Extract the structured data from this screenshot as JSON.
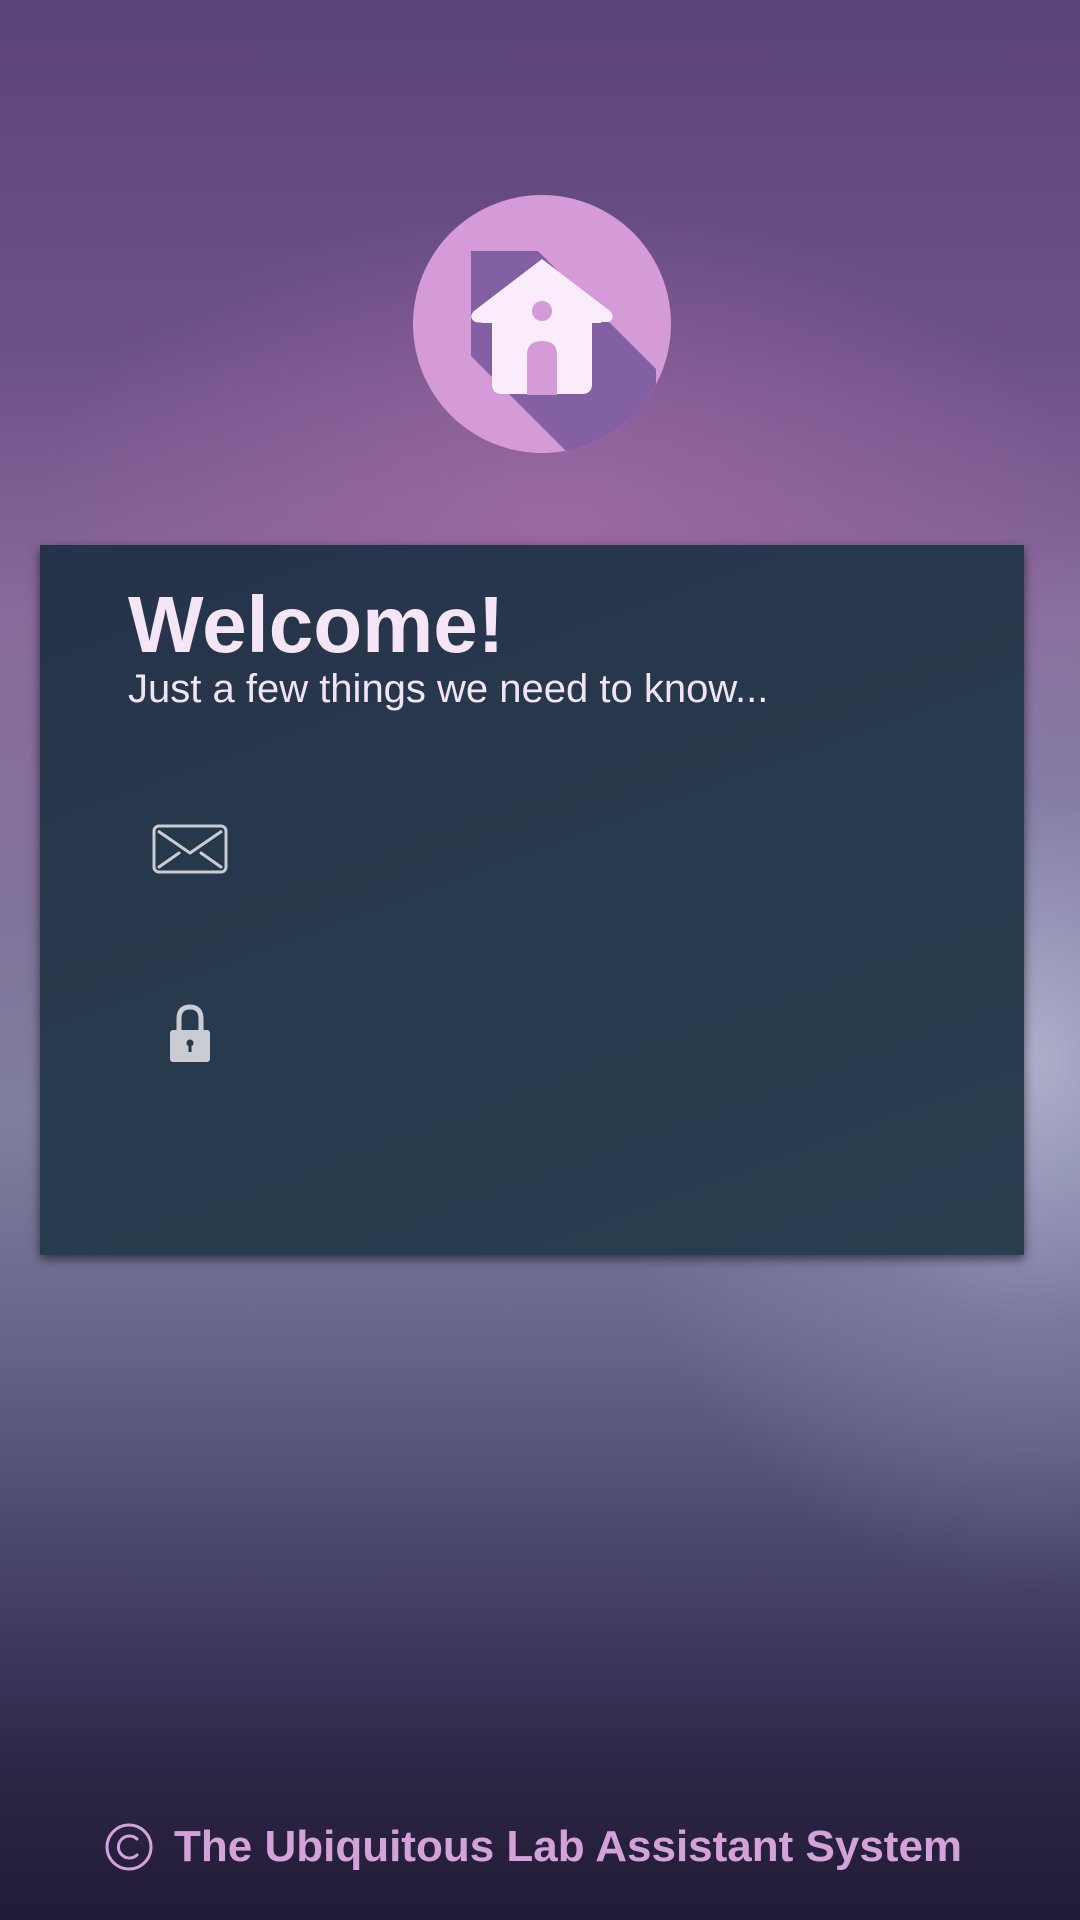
{
  "colors": {
    "logo_circle": "#d59ad8",
    "logo_shadow": "#8360a4",
    "logo_house": "#fbecfb",
    "card_background": "#27384c",
    "title_text": "#f4e6f6",
    "footer_text": "#d3a2d8",
    "icon_color": "#c9cdd3"
  },
  "logo": {
    "icon": "house-icon"
  },
  "login_card": {
    "title": "Welcome!",
    "subtitle": "Just a few things we need to know...",
    "email_field": {
      "icon": "envelope-icon",
      "value": "",
      "placeholder": ""
    },
    "password_field": {
      "icon": "lock-icon",
      "value": "",
      "placeholder": ""
    }
  },
  "footer": {
    "icon": "copyright-icon",
    "text": "The Ubiquitous Lab Assistant System"
  }
}
